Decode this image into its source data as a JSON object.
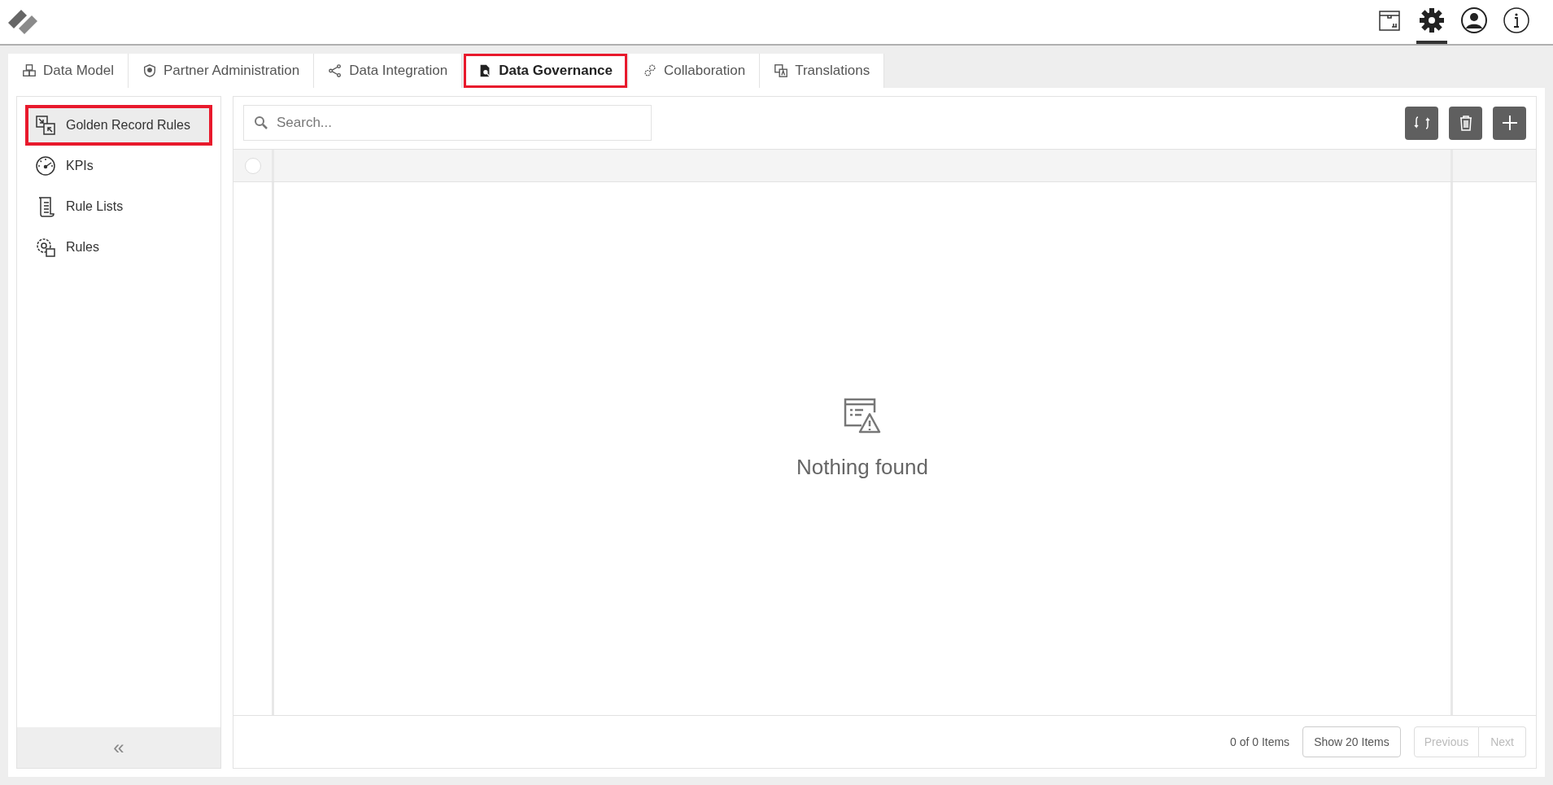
{
  "header": {
    "icons": [
      {
        "kind": "package",
        "selected": false
      },
      {
        "kind": "settings",
        "selected": true
      },
      {
        "kind": "user",
        "selected": false
      },
      {
        "kind": "info",
        "selected": false
      }
    ]
  },
  "tabs": [
    {
      "label": "Data Model",
      "kind": "cubes",
      "selected": false
    },
    {
      "label": "Partner Administration",
      "kind": "shield",
      "selected": false
    },
    {
      "label": "Data Integration",
      "kind": "share",
      "selected": false
    },
    {
      "label": "Data Governance",
      "kind": "doc",
      "selected": true
    },
    {
      "label": "Collaboration",
      "kind": "gears",
      "selected": false
    },
    {
      "label": "Translations",
      "kind": "translate",
      "selected": false
    }
  ],
  "sidebar": {
    "items": [
      {
        "label": "Golden Record Rules",
        "kind": "merge",
        "selected": true
      },
      {
        "label": "KPIs",
        "kind": "gauge",
        "selected": false
      },
      {
        "label": "Rule Lists",
        "kind": "scroll",
        "selected": false
      },
      {
        "label": "Rules",
        "kind": "gear",
        "selected": false
      }
    ],
    "collapse": "«"
  },
  "table": {
    "search": {
      "placeholder": "Search..."
    },
    "toolbar": [
      {
        "kind": "sync"
      },
      {
        "kind": "delete"
      },
      {
        "kind": "add"
      }
    ],
    "select_all": {
      "checked": false
    },
    "empty_message": "Nothing found"
  },
  "footer": {
    "count": "0 of 0 Items",
    "page_size": "Show 20 Items",
    "previous": "Previous",
    "next": "Next"
  }
}
